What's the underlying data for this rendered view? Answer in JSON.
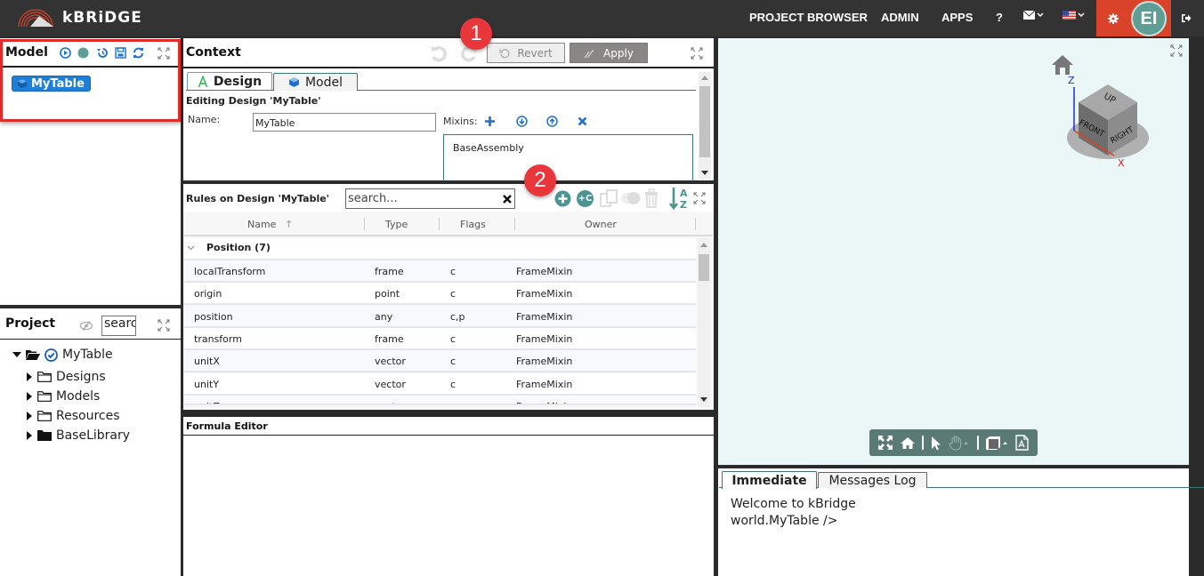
{
  "app": {
    "logo_text": "kBRiDGE",
    "nav": {
      "project_browser": "PROJECT BROWSER",
      "admin": "ADMIN",
      "apps": "APPS",
      "help": "?"
    },
    "avatar_initials": "EI",
    "accent_color": "#d9432a",
    "avatar_color": "#5e9e95"
  },
  "model_panel": {
    "title": "Model",
    "selected_item": "MyTable",
    "icons": [
      "play-circle-icon",
      "status-dot-icon",
      "history-icon",
      "save-icon",
      "refresh-icon",
      "expand-icon"
    ]
  },
  "project_panel": {
    "title": "Project",
    "search_value": "searc",
    "tree": [
      {
        "label": "MyTable",
        "level": 0,
        "expanded": true,
        "icon": "folder-open-icon",
        "checked": true
      },
      {
        "label": "Designs",
        "level": 1,
        "expanded": false,
        "icon": "folder-outline-icon"
      },
      {
        "label": "Models",
        "level": 1,
        "expanded": false,
        "icon": "folder-outline-icon"
      },
      {
        "label": "Resources",
        "level": 1,
        "expanded": false,
        "icon": "folder-outline-icon"
      },
      {
        "label": "BaseLibrary",
        "level": 1,
        "expanded": false,
        "icon": "folder-solid-icon"
      }
    ]
  },
  "context_panel": {
    "title": "Context",
    "revert_label": "Revert",
    "apply_label": "Apply",
    "tabs": [
      {
        "label": "Design",
        "active": true
      },
      {
        "label": "Model",
        "active": false
      }
    ],
    "editing_label": "Editing Design 'MyTable'",
    "name_label": "Name:",
    "name_value": "MyTable",
    "mixins_label": "Mixins:",
    "mixins": [
      "BaseAssembly"
    ]
  },
  "rules_panel": {
    "title": "Rules on Design 'MyTable'",
    "search_placeholder": "search...",
    "columns": [
      "Name",
      "Type",
      "Flags",
      "Owner"
    ],
    "sort_indicator": "↑",
    "group": {
      "label": "Position (7)",
      "expanded": true
    },
    "rows": [
      {
        "name": "localTransform",
        "type": "frame",
        "flags": "c",
        "owner": "FrameMixin"
      },
      {
        "name": "origin",
        "type": "point",
        "flags": "c",
        "owner": "FrameMixin"
      },
      {
        "name": "position",
        "type": "any",
        "flags": "c,p",
        "owner": "FrameMixin"
      },
      {
        "name": "transform",
        "type": "frame",
        "flags": "c",
        "owner": "FrameMixin"
      },
      {
        "name": "unitX",
        "type": "vector",
        "flags": "c",
        "owner": "FrameMixin"
      },
      {
        "name": "unitY",
        "type": "vector",
        "flags": "c",
        "owner": "FrameMixin"
      },
      {
        "name": "unitZ",
        "type": "vector",
        "flags": "c",
        "owner": "FrameMixin"
      }
    ],
    "add_rule_label": "+C"
  },
  "formula_panel": {
    "title": "Formula Editor"
  },
  "viewer": {
    "cube_faces": {
      "top": "UP",
      "front": "FRONT",
      "right": "RIGHT"
    },
    "axis_z": "Z",
    "axis_x": "X"
  },
  "console": {
    "tabs": [
      {
        "label": "Immediate",
        "active": true
      },
      {
        "label": "Messages Log",
        "active": false
      }
    ],
    "lines": [
      "Welcome to kBridge",
      "world.MyTable />"
    ]
  },
  "callouts": [
    "1",
    "2"
  ]
}
